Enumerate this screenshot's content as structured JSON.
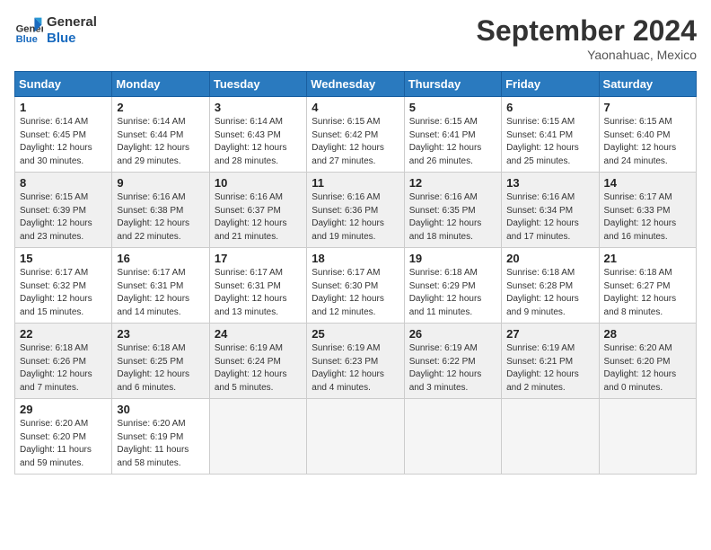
{
  "header": {
    "logo_text_1": "General",
    "logo_text_2": "Blue",
    "month": "September 2024",
    "location": "Yaonahuac, Mexico"
  },
  "weekdays": [
    "Sunday",
    "Monday",
    "Tuesday",
    "Wednesday",
    "Thursday",
    "Friday",
    "Saturday"
  ],
  "weeks": [
    [
      {
        "day": "1",
        "info": "Sunrise: 6:14 AM\nSunset: 6:45 PM\nDaylight: 12 hours\nand 30 minutes."
      },
      {
        "day": "2",
        "info": "Sunrise: 6:14 AM\nSunset: 6:44 PM\nDaylight: 12 hours\nand 29 minutes."
      },
      {
        "day": "3",
        "info": "Sunrise: 6:14 AM\nSunset: 6:43 PM\nDaylight: 12 hours\nand 28 minutes."
      },
      {
        "day": "4",
        "info": "Sunrise: 6:15 AM\nSunset: 6:42 PM\nDaylight: 12 hours\nand 27 minutes."
      },
      {
        "day": "5",
        "info": "Sunrise: 6:15 AM\nSunset: 6:41 PM\nDaylight: 12 hours\nand 26 minutes."
      },
      {
        "day": "6",
        "info": "Sunrise: 6:15 AM\nSunset: 6:41 PM\nDaylight: 12 hours\nand 25 minutes."
      },
      {
        "day": "7",
        "info": "Sunrise: 6:15 AM\nSunset: 6:40 PM\nDaylight: 12 hours\nand 24 minutes."
      }
    ],
    [
      {
        "day": "8",
        "info": "Sunrise: 6:15 AM\nSunset: 6:39 PM\nDaylight: 12 hours\nand 23 minutes."
      },
      {
        "day": "9",
        "info": "Sunrise: 6:16 AM\nSunset: 6:38 PM\nDaylight: 12 hours\nand 22 minutes."
      },
      {
        "day": "10",
        "info": "Sunrise: 6:16 AM\nSunset: 6:37 PM\nDaylight: 12 hours\nand 21 minutes."
      },
      {
        "day": "11",
        "info": "Sunrise: 6:16 AM\nSunset: 6:36 PM\nDaylight: 12 hours\nand 19 minutes."
      },
      {
        "day": "12",
        "info": "Sunrise: 6:16 AM\nSunset: 6:35 PM\nDaylight: 12 hours\nand 18 minutes."
      },
      {
        "day": "13",
        "info": "Sunrise: 6:16 AM\nSunset: 6:34 PM\nDaylight: 12 hours\nand 17 minutes."
      },
      {
        "day": "14",
        "info": "Sunrise: 6:17 AM\nSunset: 6:33 PM\nDaylight: 12 hours\nand 16 minutes."
      }
    ],
    [
      {
        "day": "15",
        "info": "Sunrise: 6:17 AM\nSunset: 6:32 PM\nDaylight: 12 hours\nand 15 minutes."
      },
      {
        "day": "16",
        "info": "Sunrise: 6:17 AM\nSunset: 6:31 PM\nDaylight: 12 hours\nand 14 minutes."
      },
      {
        "day": "17",
        "info": "Sunrise: 6:17 AM\nSunset: 6:31 PM\nDaylight: 12 hours\nand 13 minutes."
      },
      {
        "day": "18",
        "info": "Sunrise: 6:17 AM\nSunset: 6:30 PM\nDaylight: 12 hours\nand 12 minutes."
      },
      {
        "day": "19",
        "info": "Sunrise: 6:18 AM\nSunset: 6:29 PM\nDaylight: 12 hours\nand 11 minutes."
      },
      {
        "day": "20",
        "info": "Sunrise: 6:18 AM\nSunset: 6:28 PM\nDaylight: 12 hours\nand 9 minutes."
      },
      {
        "day": "21",
        "info": "Sunrise: 6:18 AM\nSunset: 6:27 PM\nDaylight: 12 hours\nand 8 minutes."
      }
    ],
    [
      {
        "day": "22",
        "info": "Sunrise: 6:18 AM\nSunset: 6:26 PM\nDaylight: 12 hours\nand 7 minutes."
      },
      {
        "day": "23",
        "info": "Sunrise: 6:18 AM\nSunset: 6:25 PM\nDaylight: 12 hours\nand 6 minutes."
      },
      {
        "day": "24",
        "info": "Sunrise: 6:19 AM\nSunset: 6:24 PM\nDaylight: 12 hours\nand 5 minutes."
      },
      {
        "day": "25",
        "info": "Sunrise: 6:19 AM\nSunset: 6:23 PM\nDaylight: 12 hours\nand 4 minutes."
      },
      {
        "day": "26",
        "info": "Sunrise: 6:19 AM\nSunset: 6:22 PM\nDaylight: 12 hours\nand 3 minutes."
      },
      {
        "day": "27",
        "info": "Sunrise: 6:19 AM\nSunset: 6:21 PM\nDaylight: 12 hours\nand 2 minutes."
      },
      {
        "day": "28",
        "info": "Sunrise: 6:20 AM\nSunset: 6:20 PM\nDaylight: 12 hours\nand 0 minutes."
      }
    ],
    [
      {
        "day": "29",
        "info": "Sunrise: 6:20 AM\nSunset: 6:20 PM\nDaylight: 11 hours\nand 59 minutes."
      },
      {
        "day": "30",
        "info": "Sunrise: 6:20 AM\nSunset: 6:19 PM\nDaylight: 11 hours\nand 58 minutes."
      },
      {
        "day": "",
        "info": ""
      },
      {
        "day": "",
        "info": ""
      },
      {
        "day": "",
        "info": ""
      },
      {
        "day": "",
        "info": ""
      },
      {
        "day": "",
        "info": ""
      }
    ]
  ]
}
